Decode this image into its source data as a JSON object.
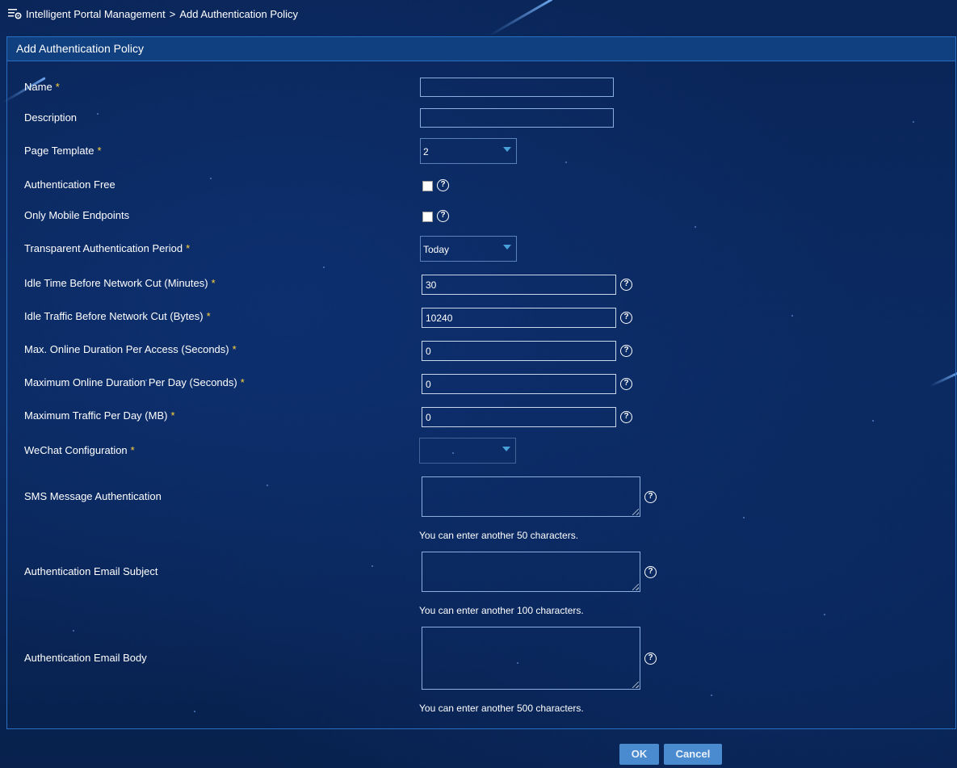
{
  "breadcrumb": {
    "root": "Intelligent Portal Management",
    "separator": ">",
    "current": "Add Authentication Policy"
  },
  "panel": {
    "title": "Add Authentication Policy"
  },
  "form": {
    "required_marker": "*",
    "name": {
      "label": "Name",
      "value": ""
    },
    "description": {
      "label": "Description",
      "value": ""
    },
    "page_template": {
      "label": "Page Template",
      "value": "2"
    },
    "authentication_free": {
      "label": "Authentication Free",
      "checked": false
    },
    "only_mobile_endpoints": {
      "label": "Only Mobile Endpoints",
      "checked": false
    },
    "transparent_auth_period": {
      "label": "Transparent Authentication Period",
      "value": "Today"
    },
    "idle_time": {
      "label": "Idle Time Before Network Cut (Minutes)",
      "value": "30"
    },
    "idle_traffic": {
      "label": "Idle Traffic Before Network Cut (Bytes)",
      "value": "10240"
    },
    "max_online_per_access": {
      "label": "Max. Online Duration Per Access (Seconds)",
      "value": "0"
    },
    "max_online_per_day": {
      "label": "Maximum Online Duration Per Day (Seconds)",
      "value": "0"
    },
    "max_traffic_per_day": {
      "label": "Maximum Traffic Per Day (MB)",
      "value": "0"
    },
    "wechat_config": {
      "label": "WeChat Configuration",
      "value": ""
    },
    "sms_auth": {
      "label": "SMS Message Authentication",
      "hint": "You can enter another 50 characters."
    },
    "email_subject": {
      "label": "Authentication Email Subject",
      "hint": "You can enter another 100 characters."
    },
    "email_body": {
      "label": "Authentication Email Body",
      "hint": "You can enter another 500 characters."
    }
  },
  "buttons": {
    "ok": "OK",
    "cancel": "Cancel"
  },
  "icons": {
    "breadcrumb": "menu-gear-icon",
    "help": "help-circle-icon",
    "dropdown": "caret-down-icon"
  },
  "help_glyph": "?",
  "colors": {
    "background": "#0a2557",
    "panel_header": "#10407f",
    "border": "#2a6fc0",
    "required": "#ffd43b",
    "button": "#4a8bd0"
  }
}
